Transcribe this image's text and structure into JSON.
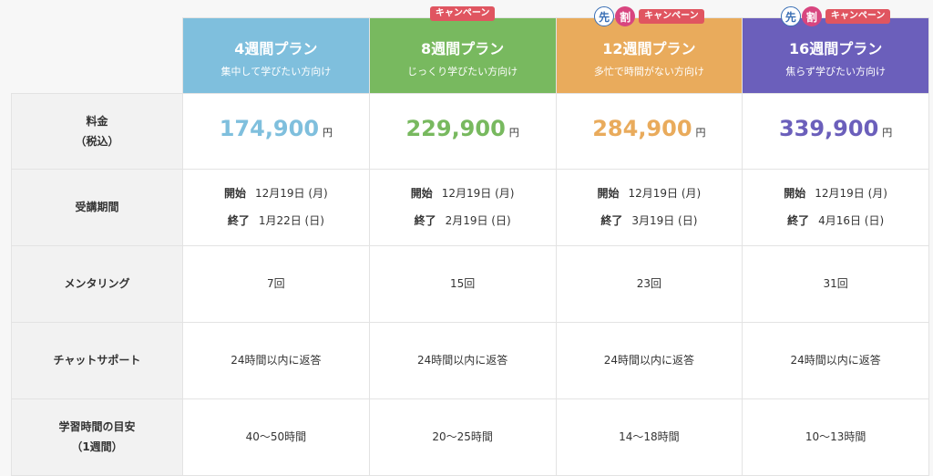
{
  "plans": [
    {
      "name": "4週間プラン",
      "sub": "集中して学びたい方向け",
      "color": "#7fbfdd",
      "price": "174,900",
      "start": "12月19日 (月)",
      "end": "1月22日 (日)",
      "mentoring": "7回",
      "chat": "24時間以内に返答",
      "study": "40〜50時間",
      "campaign": "",
      "senwari": false
    },
    {
      "name": "8週間プラン",
      "sub": "じっくり学びたい方向け",
      "color": "#78b95f",
      "price": "229,900",
      "start": "12月19日 (月)",
      "end": "2月19日 (日)",
      "mentoring": "15回",
      "chat": "24時間以内に返答",
      "study": "20〜25時間",
      "campaign": "キャンペーン",
      "senwari": false
    },
    {
      "name": "12週間プラン",
      "sub": "多忙で時間がない方向け",
      "color": "#e9ab5c",
      "price": "284,900",
      "start": "12月19日 (月)",
      "end": "3月19日 (日)",
      "mentoring": "23回",
      "chat": "24時間以内に返答",
      "study": "14〜18時間",
      "campaign": "キャンペーン",
      "senwari": true
    },
    {
      "name": "16週間プラン",
      "sub": "焦らず学びたい方向け",
      "color": "#6b5fbb",
      "price": "339,900",
      "start": "12月19日 (月)",
      "end": "4月16日 (日)",
      "mentoring": "31回",
      "chat": "24時間以内に返答",
      "study": "10〜13時間",
      "campaign": "キャンペーン",
      "senwari": true
    }
  ],
  "labels": {
    "price": "料金",
    "price_sub": "（税込）",
    "period": "受講期間",
    "mentoring": "メンタリング",
    "chat": "チャットサポート",
    "study": "学習時間の目安",
    "study_sub": "（1週間）",
    "start": "開始",
    "end": "終了",
    "yen": "円",
    "sen": "先",
    "wari": "割"
  },
  "price_colors": [
    "#7fbfdd",
    "#78b95f",
    "#e9ab5c",
    "#6b5fbb"
  ]
}
